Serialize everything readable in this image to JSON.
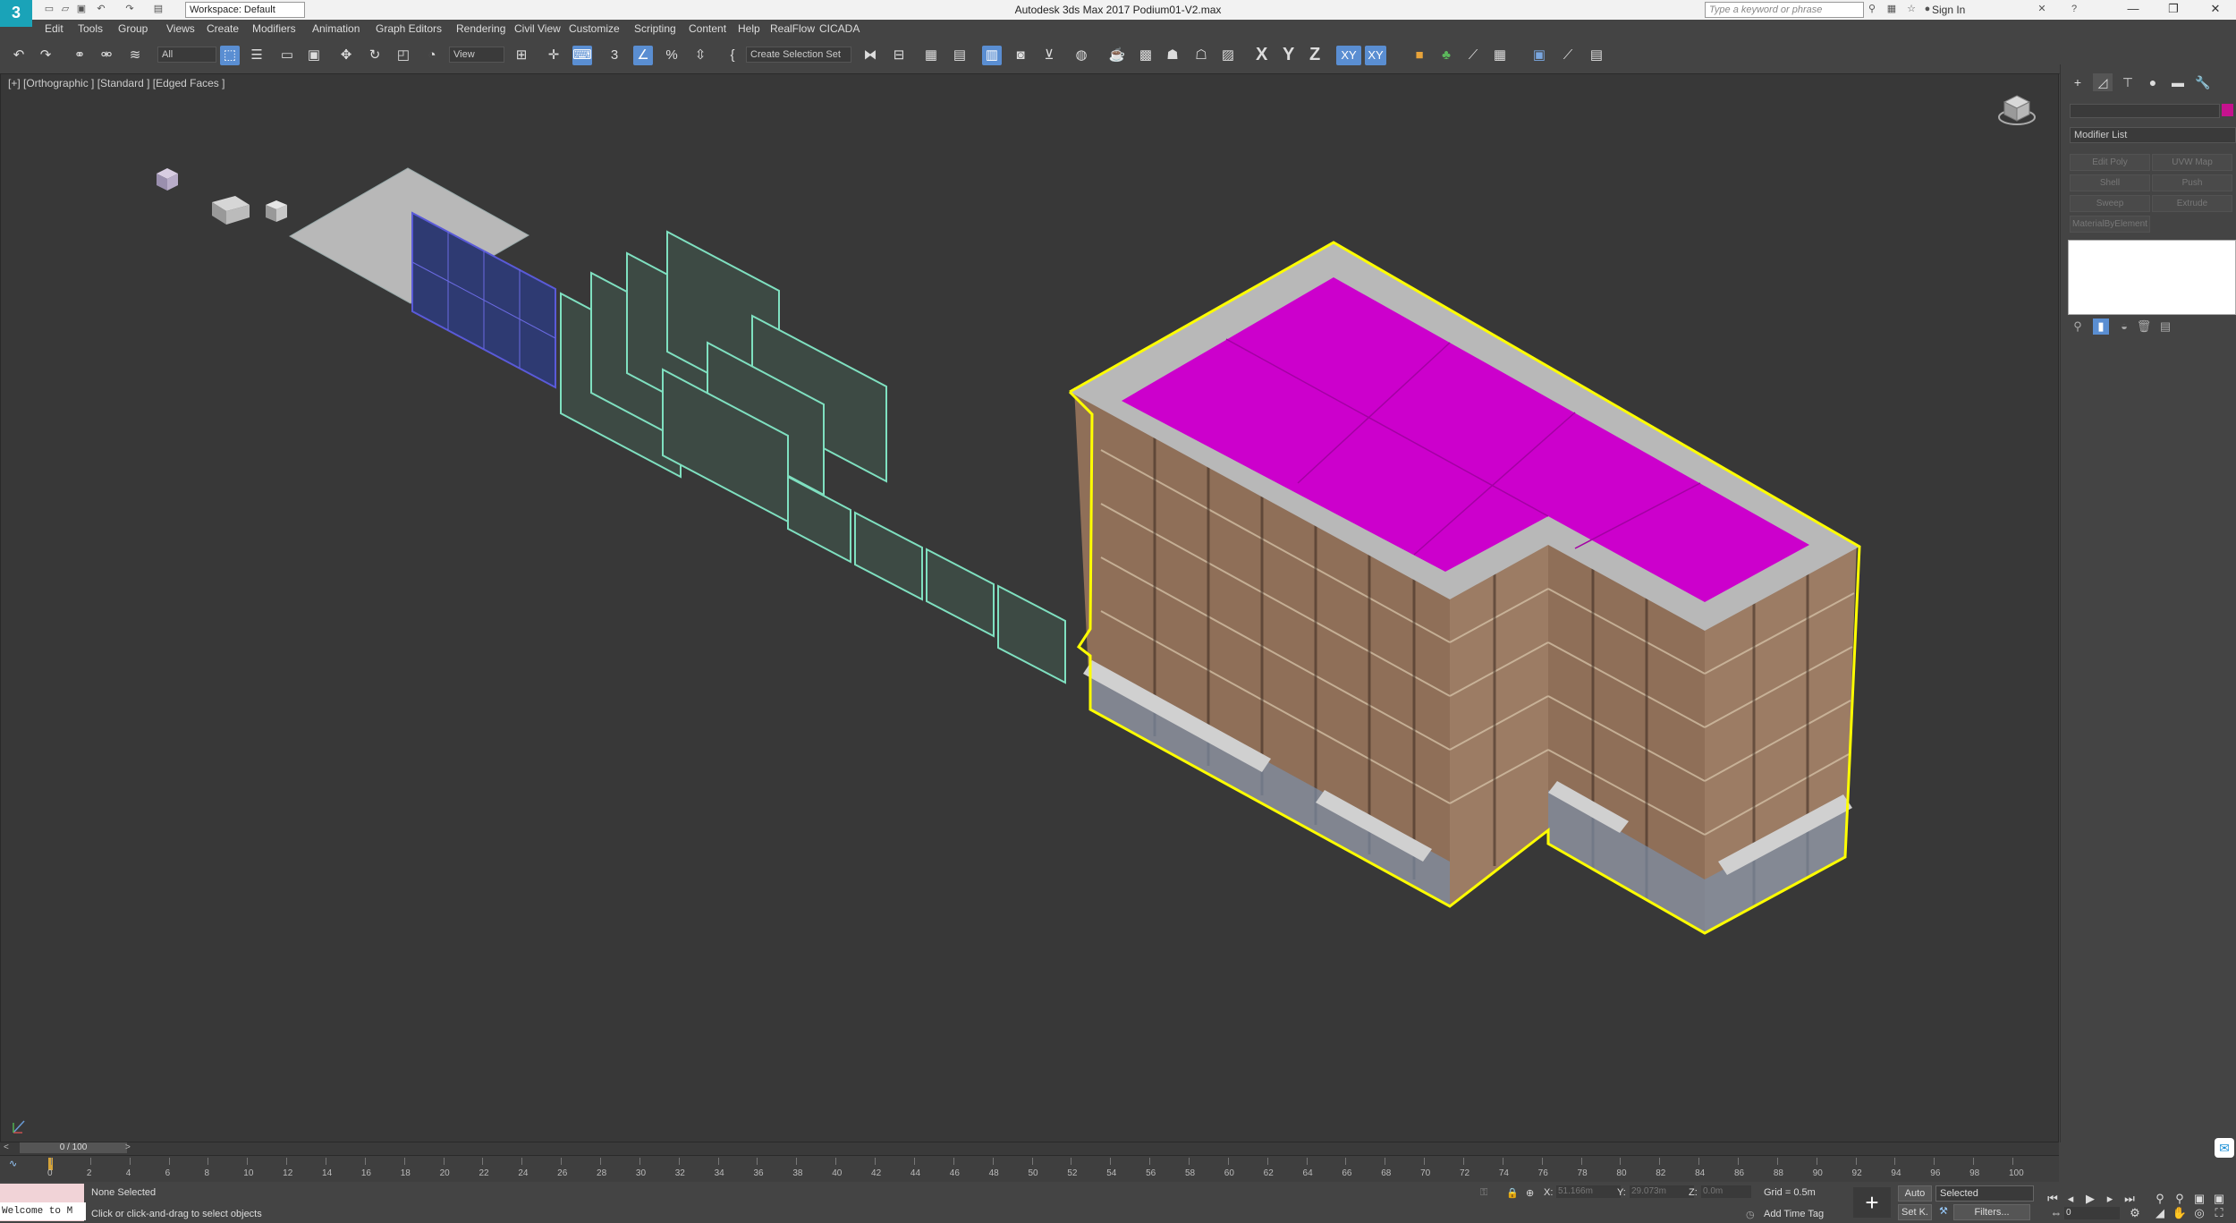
{
  "app": {
    "logo": "3",
    "title": "Autodesk 3ds Max 2017     Podium01-V2.max",
    "workspace": "Workspace: Default",
    "search_placeholder": "Type a keyword or phrase",
    "sign_in": "Sign In"
  },
  "menu": [
    "Edit",
    "Tools",
    "Group",
    "Views",
    "Create",
    "Modifiers",
    "Animation",
    "Graph Editors",
    "Rendering",
    "Civil View",
    "Customize",
    "Scripting",
    "Content",
    "Help",
    "RealFlow",
    "CICADA"
  ],
  "toolbar": {
    "filter_dropdown": "All",
    "ref_coord": "View",
    "selection_set": "Create Selection Set",
    "axes": [
      "X",
      "Y",
      "Z",
      "XY",
      "XY"
    ]
  },
  "viewport": {
    "label": "[+] [Orthographic ] [Standard ] [Edged Faces ]"
  },
  "command_panel": {
    "modifier_list": "Modifier List",
    "modifier_buttons": [
      "Edit Poly",
      "UVW Map",
      "Shell",
      "Push",
      "Sweep",
      "Extrude",
      "MaterialByElement"
    ],
    "object_color": "#c6128e"
  },
  "timeline": {
    "frame": "0 / 100",
    "ticks": [
      "0",
      "2",
      "4",
      "6",
      "8",
      "10",
      "12",
      "14",
      "16",
      "18",
      "20",
      "22",
      "24",
      "26",
      "28",
      "30",
      "32",
      "34",
      "36",
      "38",
      "40",
      "42",
      "44",
      "46",
      "48",
      "50",
      "52",
      "54",
      "56",
      "58",
      "60",
      "62",
      "64",
      "66",
      "68",
      "70",
      "72",
      "74",
      "76",
      "78",
      "80",
      "82",
      "84",
      "86",
      "88",
      "90",
      "92",
      "94",
      "96",
      "98",
      "100"
    ]
  },
  "status": {
    "maxscript": "Welcome to M",
    "selection": "None Selected",
    "prompt": "Click or click-and-drag to select objects",
    "x_label": "X:",
    "x_value": "51.166m",
    "y_label": "Y:",
    "y_value": "29.073m",
    "z_label": "Z:",
    "z_value": "0.0m",
    "grid": "Grid = 0.5m",
    "add_time_tag": "Add Time Tag",
    "auto": "Auto",
    "set_key": "Set K.",
    "key_mode": "Selected",
    "filters": "Filters...",
    "current_frame": "0"
  },
  "colors": {
    "selection_highlight": "#ffff00",
    "roof": "#cc00cc",
    "facade": "#a0806a",
    "glass_panel": "#4040a0"
  }
}
